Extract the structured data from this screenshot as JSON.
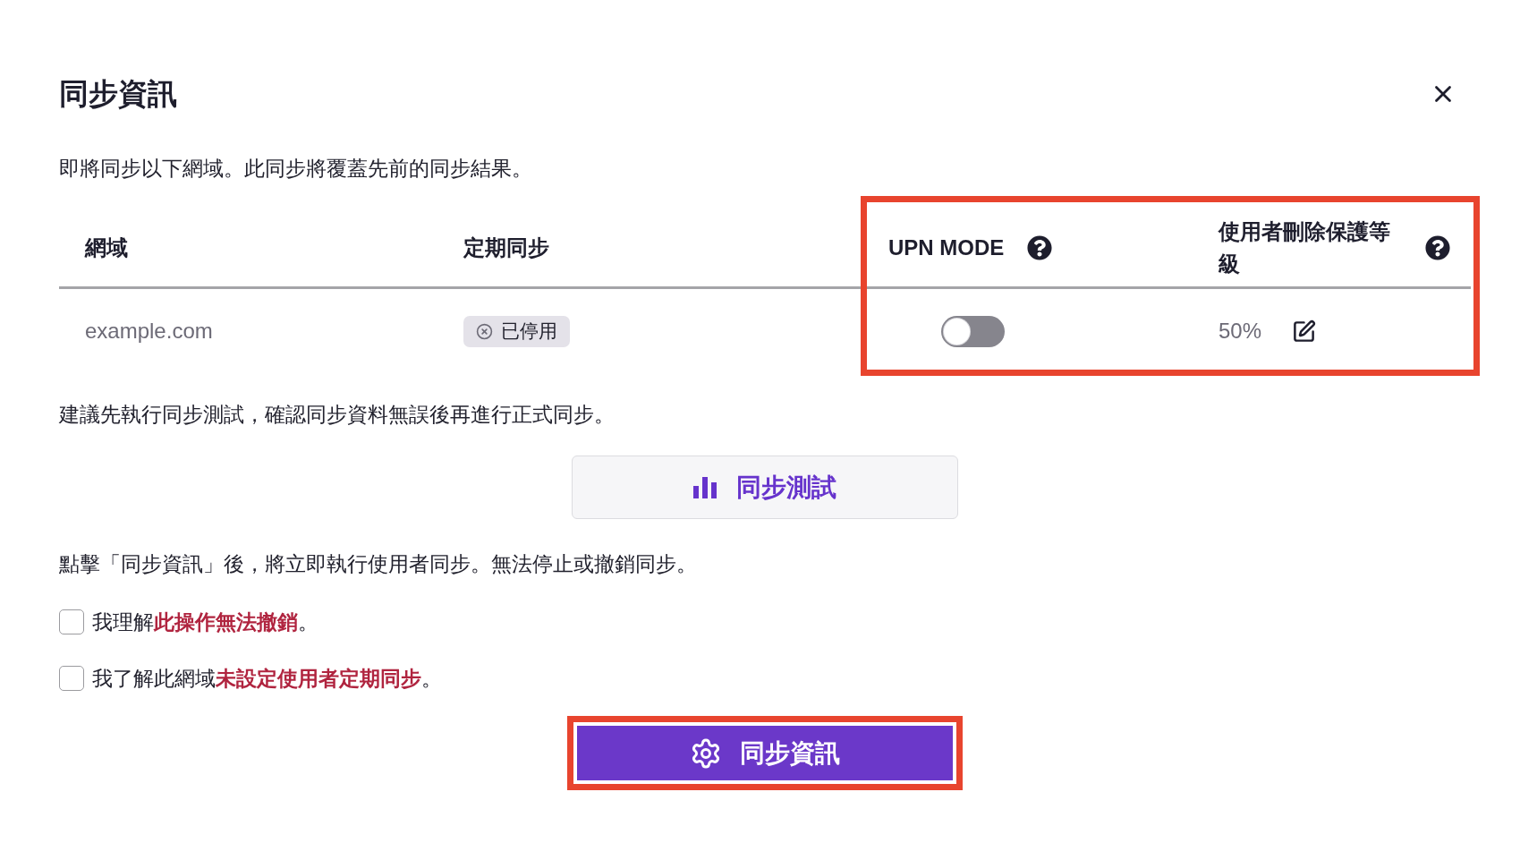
{
  "dialog": {
    "title": "同步資訊"
  },
  "intro": "即將同步以下網域。此同步將覆蓋先前的同步結果。",
  "table": {
    "columns": [
      {
        "label": "網域",
        "help": false,
        "highlighted": false
      },
      {
        "label": "定期同步",
        "help": false,
        "highlighted": false
      },
      {
        "label": "UPN MODE",
        "help": true,
        "highlighted": true
      },
      {
        "label": "使用者刪除保護等級",
        "help": true,
        "highlighted": true
      }
    ],
    "rows": [
      {
        "domain": "example.com",
        "schedule": {
          "label": "已停用",
          "enabled": false
        },
        "upn_mode": {
          "on": false
        },
        "protection": "50%"
      }
    ]
  },
  "advice": "建議先執行同步測試，確認同步資料無誤後再進行正式同步。",
  "test_button": {
    "label": "同步測試"
  },
  "warning": "點擊「同步資訊」後，將立即執行使用者同步。無法停止或撤銷同步。",
  "confirmations": [
    {
      "text": "我理解**此操作無法撤銷**。",
      "checked": false
    },
    {
      "text": "我了解此網域**未設定使用者定期同步**。",
      "checked": false
    }
  ],
  "submit_button": {
    "label": "同步資訊",
    "highlighted": true
  }
}
